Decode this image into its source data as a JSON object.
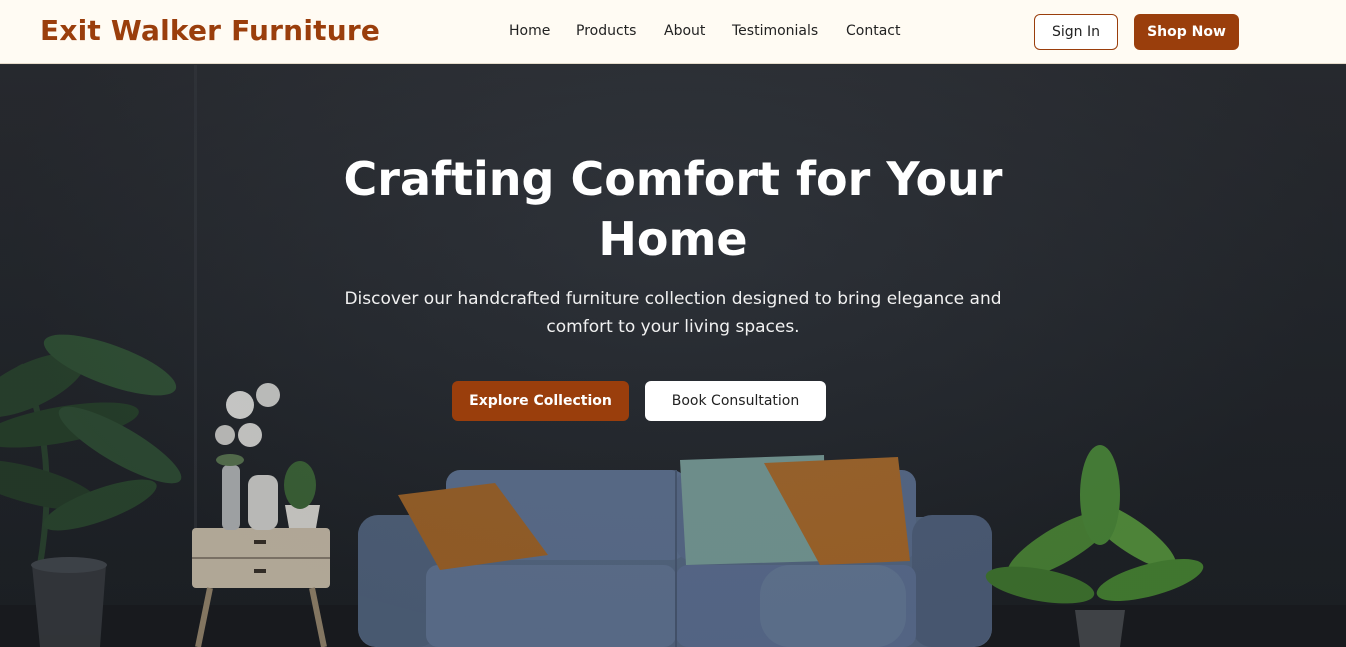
{
  "header": {
    "logo": "Exit Walker Furniture",
    "nav": [
      "Home",
      "Products",
      "About",
      "Testimonials",
      "Contact"
    ],
    "sign_in": "Sign In",
    "shop_now": "Shop Now"
  },
  "hero": {
    "title": "Crafting Comfort for Your Home",
    "subtitle": "Discover our handcrafted furniture collection designed to bring elegance and comfort to your living spaces.",
    "primary_cta": "Explore Collection",
    "secondary_cta": "Book Consultation"
  },
  "colors": {
    "brand": "#9a3e0c",
    "header_bg": "#fffbf3",
    "hero_bg": "#2a2e33"
  }
}
